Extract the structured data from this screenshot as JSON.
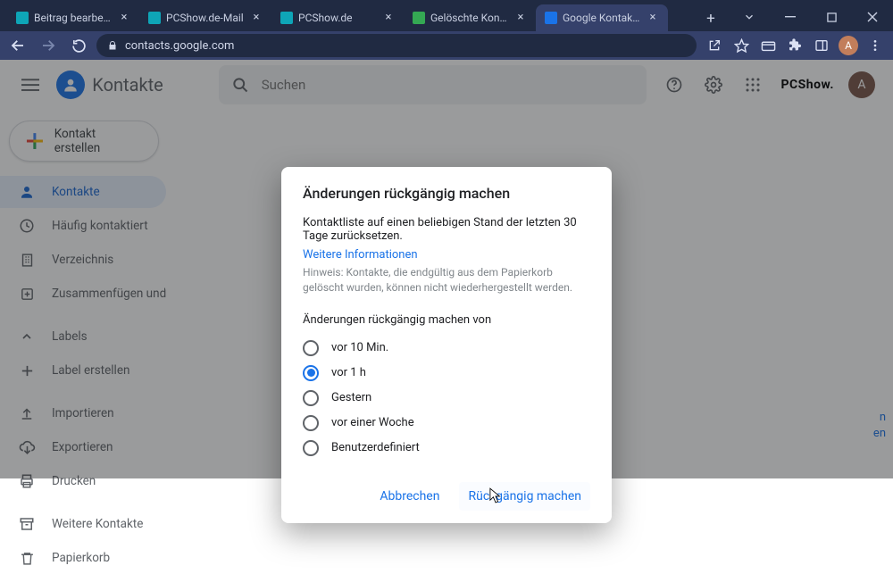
{
  "browser": {
    "tabs": [
      {
        "label": "Beitrag bearbeiten „Gelöscht",
        "favicon": "#0ea5b7"
      },
      {
        "label": "PCShow.de-Mail",
        "favicon": "#0ea5b7"
      },
      {
        "label": "PCShow.de",
        "favicon": "#0ea5b7"
      },
      {
        "label": "Gelöschte Kontakte wiederh",
        "favicon": "#34a853"
      },
      {
        "label": "Google Kontakte",
        "favicon": "#1a73e8",
        "active": true
      }
    ],
    "url": "contacts.google.com"
  },
  "appbar": {
    "brand": "Kontakte",
    "search_placeholder": "Suchen",
    "pcshow_label": "PCShow.",
    "avatar_letter": "A"
  },
  "sidebar": {
    "create_label": "Kontakt erstellen",
    "items": [
      {
        "label": "Kontakte",
        "icon": "person",
        "selected": true
      },
      {
        "label": "Häufig kontaktiert",
        "icon": "clock"
      },
      {
        "label": "Verzeichnis",
        "icon": "building"
      },
      {
        "label": "Zusammenfügen und k...",
        "icon": "merge"
      }
    ],
    "labels_header": "Labels",
    "label_create": "Label erstellen",
    "tools": [
      {
        "label": "Importieren",
        "icon": "upload"
      },
      {
        "label": "Exportieren",
        "icon": "cloud-down"
      },
      {
        "label": "Drucken",
        "icon": "print"
      }
    ],
    "other": [
      {
        "label": "Weitere Kontakte",
        "icon": "archive"
      },
      {
        "label": "Papierkorb",
        "icon": "trash"
      }
    ]
  },
  "dialog": {
    "title": "Änderungen rückgängig machen",
    "description": "Kontaktliste auf einen beliebigen Stand der letzten 30 Tage zurücksetzen.",
    "more_info": "Weitere Informationen",
    "hint": "Hinweis: Kontakte, die endgültig aus dem Papierkorb gelöscht wurden, können nicht wiederhergestellt werden.",
    "subheading": "Änderungen rückgängig machen von",
    "options": [
      {
        "label": "vor 10 Min."
      },
      {
        "label": "vor 1 h",
        "selected": true
      },
      {
        "label": "Gestern"
      },
      {
        "label": "vor einer Woche"
      },
      {
        "label": "Benutzerdefiniert"
      }
    ],
    "cancel": "Abbrechen",
    "confirm": "Rückgängig machen"
  },
  "peek": {
    "line1": "n",
    "line2": "en"
  }
}
